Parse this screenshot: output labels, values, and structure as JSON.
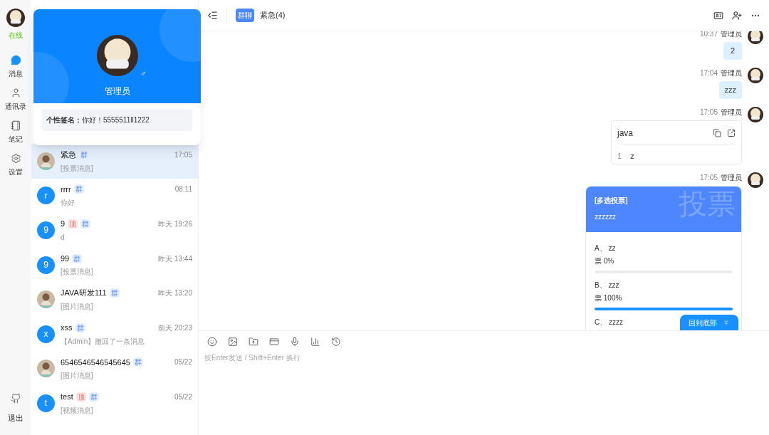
{
  "nav": {
    "status": "在线",
    "items": [
      {
        "label": "消息",
        "kind": "messages",
        "selected": true
      },
      {
        "label": "通讯录",
        "kind": "contacts",
        "selected": false
      },
      {
        "label": "笔记",
        "kind": "notes",
        "selected": false
      },
      {
        "label": "设置",
        "kind": "settings",
        "selected": false
      }
    ],
    "logout": "退出"
  },
  "profile_popup": {
    "name": "管理员",
    "gender": "♂",
    "signature_label": "个性签名：",
    "signature": "你好！5555511ll1222"
  },
  "chats": [
    {
      "name": "紧急",
      "tags": [
        {
          "kind": "group",
          "label": "群"
        }
      ],
      "time": "17:05",
      "preview": "[投票消息]",
      "avatar": {
        "kind": "picture"
      },
      "selected": true
    },
    {
      "name": "rrrr",
      "tags": [
        {
          "kind": "group",
          "label": "群"
        }
      ],
      "time": "08:11",
      "preview": "你好",
      "avatar": {
        "kind": "letter",
        "letter": "r"
      },
      "selected": false
    },
    {
      "name": "9",
      "tags": [
        {
          "kind": "pinned",
          "label": "顶"
        },
        {
          "kind": "group",
          "label": "群"
        }
      ],
      "time": "昨天 19:26",
      "preview": "d",
      "avatar": {
        "kind": "letter",
        "letter": "9"
      },
      "selected": false
    },
    {
      "name": "99",
      "tags": [
        {
          "kind": "group",
          "label": "群"
        }
      ],
      "time": "昨天 13:44",
      "preview": "[投票消息]",
      "avatar": {
        "kind": "letter",
        "letter": "9"
      },
      "selected": false
    },
    {
      "name": "JAVA研发111",
      "tags": [
        {
          "kind": "group",
          "label": "群"
        }
      ],
      "time": "昨天 13:20",
      "preview": "[图片消息]",
      "avatar": {
        "kind": "picture"
      },
      "selected": false
    },
    {
      "name": "xss",
      "tags": [
        {
          "kind": "group",
          "label": "群"
        }
      ],
      "time": "前天 20:23",
      "preview": "【Admin】撤回了一条消息",
      "avatar": {
        "kind": "letter",
        "letter": "x"
      },
      "selected": false
    },
    {
      "name": "6546546546545645",
      "tags": [
        {
          "kind": "group",
          "label": "群"
        }
      ],
      "time": "05/22",
      "preview": "[图片消息]",
      "avatar": {
        "kind": "picture"
      },
      "selected": false
    },
    {
      "name": "test",
      "tags": [
        {
          "kind": "pinned",
          "label": "顶"
        },
        {
          "kind": "group",
          "label": "群"
        }
      ],
      "time": "05/22",
      "preview": "[视频消息]",
      "avatar": {
        "kind": "letter",
        "letter": "t"
      },
      "selected": false
    }
  ],
  "chat_header": {
    "badge": "群聊",
    "title": "紧急(4)"
  },
  "messages": [
    {
      "kind": "text",
      "time": "10:37",
      "sender": "管理员",
      "text": "2"
    },
    {
      "kind": "text",
      "time": "17:04",
      "sender": "管理员",
      "text": "zzz"
    },
    {
      "kind": "code",
      "time": "17:05",
      "sender": "管理员",
      "language": "java",
      "lines": [
        {
          "number": "1",
          "code": "z"
        }
      ]
    },
    {
      "kind": "vote",
      "time": "17:05",
      "sender": "管理员",
      "vote_type": "[多选投票]",
      "question": "zzzzzz",
      "watermark": "投票",
      "options": [
        {
          "label": "A、 zz",
          "votes": "票 0%",
          "level": 0
        },
        {
          "label": "B、 zzz",
          "votes": "票 100%",
          "level": 1
        },
        {
          "label": "C、 zzzz"
        }
      ]
    }
  ],
  "scroll_button": "回到底部",
  "composer": {
    "placeholder": "按Enter发送 / Shift+Enter 换行"
  }
}
